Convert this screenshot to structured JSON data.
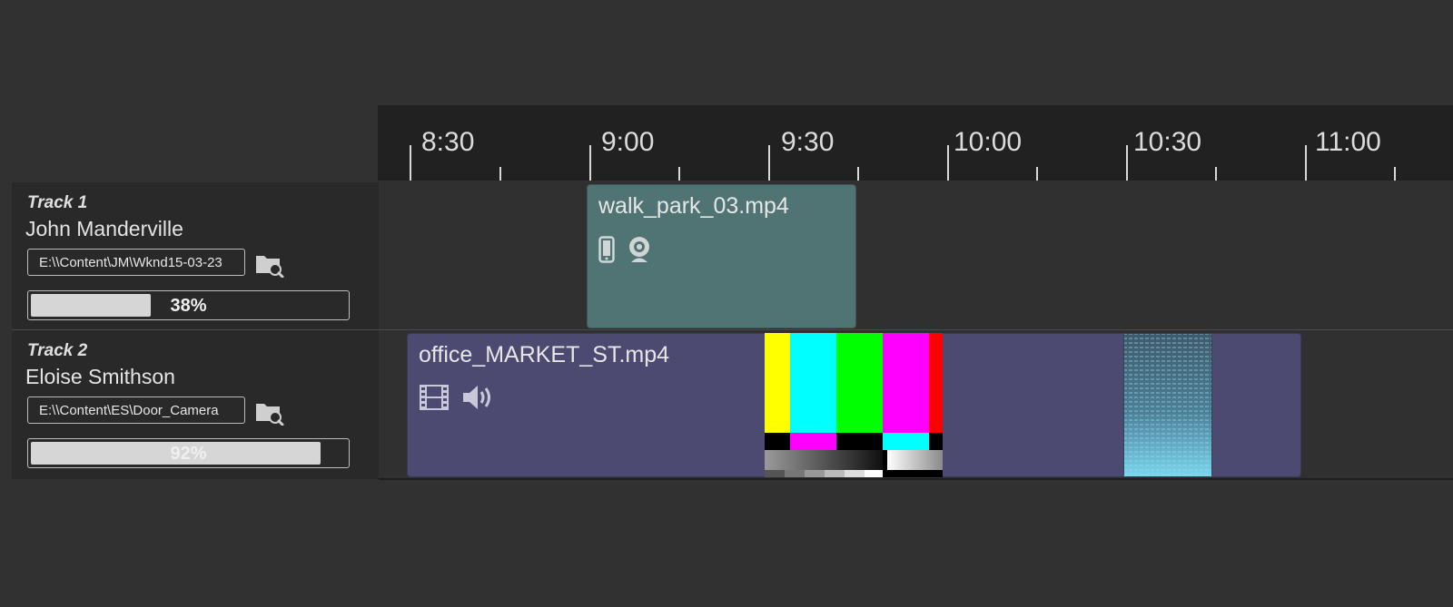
{
  "ruler": {
    "labels": [
      "8:30",
      "9:00",
      "9:30",
      "10:00",
      "10:30",
      "11:00"
    ]
  },
  "tracks": [
    {
      "number": "Track 1",
      "user": "John Manderville",
      "path": "E:\\\\Content\\JM\\Wknd15-03-23",
      "progress_value": 0.38,
      "progress_text": "38%",
      "clip": {
        "title": "walk_park_03.mp4",
        "color": "#507474",
        "icons": [
          "phone-icon",
          "webcam-icon"
        ]
      }
    },
    {
      "number": "Track 2",
      "user": "Eloise Smithson",
      "path": "E:\\\\Content\\ES\\Door_Camera",
      "progress_value": 0.92,
      "progress_text": "92%",
      "clip": {
        "title": "office_MARKET_ST.mp4",
        "color": "#4d4a72",
        "icons": [
          "film-icon",
          "speaker-icon"
        ]
      }
    }
  ],
  "colors": {
    "background": "#313131",
    "ruler": "#212121",
    "header": "#292929"
  }
}
